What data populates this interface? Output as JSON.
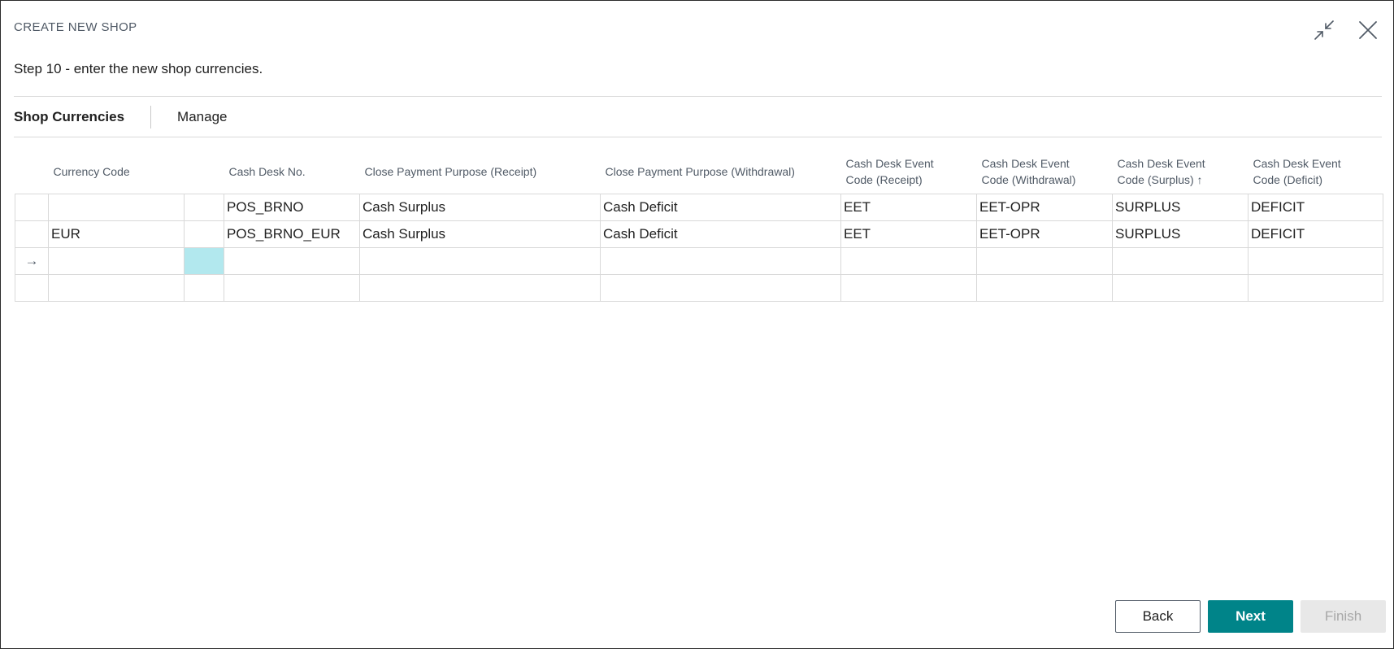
{
  "dialog": {
    "title": "CREATE NEW SHOP",
    "instruction": "Step 10 - enter the new shop currencies.",
    "collapse_icon": "collapse-icon",
    "close_icon": "close-icon"
  },
  "tabs": [
    {
      "label": "Shop Currencies",
      "active": true
    },
    {
      "label": "Manage",
      "active": false
    }
  ],
  "table": {
    "headers": {
      "currency_code": "Currency Code",
      "cash_desk_no": "Cash Desk No.",
      "close_purpose_receipt": "Close Payment Purpose (Receipt)",
      "close_purpose_withdrawal": "Close Payment Purpose (Withdrawal)",
      "event_receipt_1": "Cash Desk Event",
      "event_receipt_2": "Code (Receipt)",
      "event_withdrawal_1": "Cash Desk Event",
      "event_withdrawal_2": "Code (Withdrawal)",
      "event_surplus_1": "Cash Desk Event",
      "event_surplus_2": "Code (Surplus)",
      "sort_indicator": "↑",
      "event_deficit_1": "Cash Desk Event",
      "event_deficit_2": "Code (Deficit)"
    },
    "rows": [
      {
        "indicator": "",
        "currency_code": "",
        "blank": "",
        "cash_desk_no": "POS_BRNO",
        "close_purpose_receipt": "Cash Surplus",
        "close_purpose_withdrawal": "Cash Deficit",
        "event_receipt": "EET",
        "event_withdrawal": "EET-OPR",
        "event_surplus": "SURPLUS",
        "event_deficit": "DEFICIT"
      },
      {
        "indicator": "",
        "currency_code": "EUR",
        "blank": "",
        "cash_desk_no": "POS_BRNO_EUR",
        "close_purpose_receipt": "Cash Surplus",
        "close_purpose_withdrawal": "Cash Deficit",
        "event_receipt": "EET",
        "event_withdrawal": "EET-OPR",
        "event_surplus": "SURPLUS",
        "event_deficit": "DEFICIT"
      },
      {
        "indicator": "→",
        "currency_code": "",
        "blank": "",
        "cash_desk_no": "",
        "close_purpose_receipt": "",
        "close_purpose_withdrawal": "",
        "event_receipt": "",
        "event_withdrawal": "",
        "event_surplus": "",
        "event_deficit": ""
      },
      {
        "indicator": "",
        "currency_code": "",
        "blank": "",
        "cash_desk_no": "",
        "close_purpose_receipt": "",
        "close_purpose_withdrawal": "",
        "event_receipt": "",
        "event_withdrawal": "",
        "event_surplus": "",
        "event_deficit": ""
      }
    ]
  },
  "buttons": {
    "back": "Back",
    "next": "Next",
    "finish": "Finish"
  },
  "colors": {
    "accent": "#008489",
    "selected_cell": "#b2e8ee",
    "disabled_bg": "#e8e8e8"
  }
}
